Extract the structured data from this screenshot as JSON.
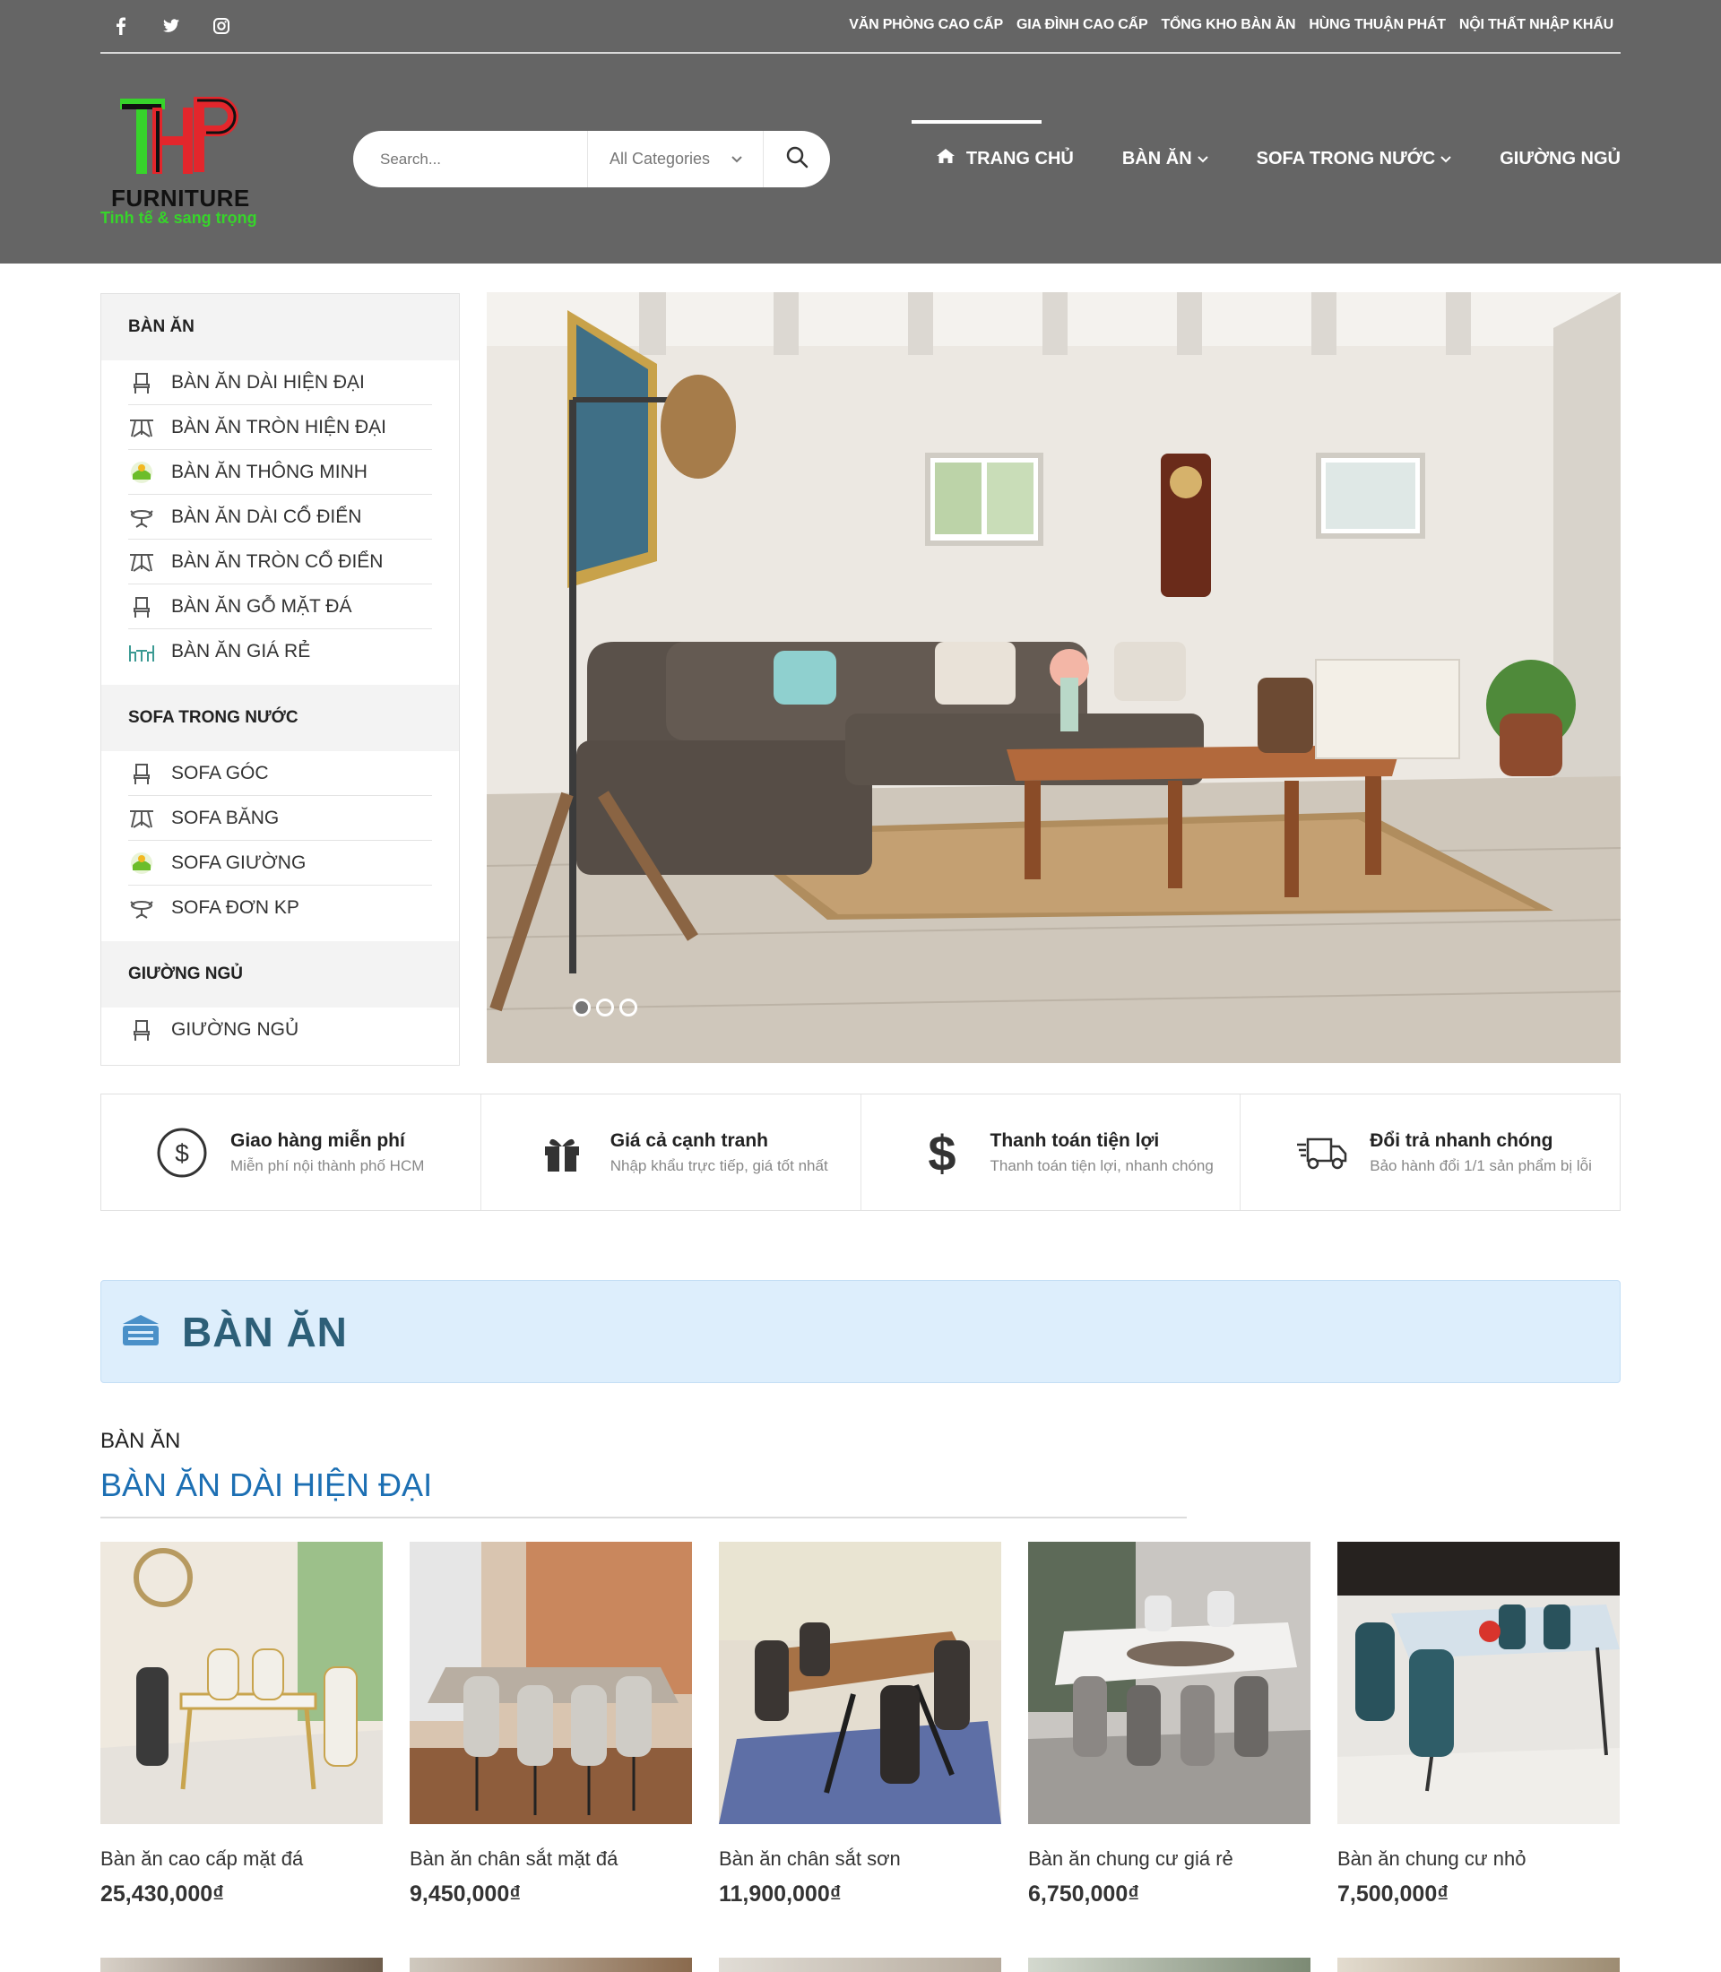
{
  "header": {
    "social": [
      "facebook-icon",
      "twitter-icon",
      "instagram-icon"
    ],
    "top_links": [
      "VĂN PHÒNG CAO CẤP",
      "GIA ĐÌNH CAO CẤP",
      "TỔNG KHO BÀN ĂN",
      "HÙNG THUẬN PHÁT",
      "NỘI THẤT NHẬP KHẨU"
    ],
    "logo": {
      "name": "FURNITURE",
      "tagline": "Tinh tế & sang trọng"
    },
    "search": {
      "placeholder": "Search...",
      "category": "All Categories"
    },
    "nav": [
      "TRANG CHỦ",
      "BÀN ĂN",
      "SOFA TRONG NƯỚC",
      "GIƯỜNG NGỦ"
    ]
  },
  "sidebar": {
    "groups": [
      {
        "title": "BÀN ĂN",
        "items": [
          "BÀN ĂN DÀI HIỆN ĐẠI",
          "BÀN ĂN TRÒN HIỆN ĐẠI",
          "BÀN ĂN THÔNG MINH",
          "BÀN ĂN DÀI CỔ ĐIỂN",
          "BÀN ĂN TRÒN CỔ ĐIỂN",
          "BÀN ĂN GỖ MẶT ĐÁ",
          "BÀN ĂN GIÁ RẺ"
        ]
      },
      {
        "title": "SOFA TRONG NƯỚC",
        "items": [
          "SOFA GÓC",
          "SOFA BĂNG",
          "SOFA GIƯỜNG",
          "SOFA ĐƠN KP"
        ]
      },
      {
        "title": "GIƯỜNG NGỦ",
        "items": [
          "GIƯỜNG NGỦ"
        ]
      }
    ]
  },
  "slider": {
    "slides": 3,
    "active": 1
  },
  "features": [
    {
      "icon": "dollar-circle-icon",
      "title": "Giao hàng miễn phí",
      "sub": "Miễn phí nội thành phố HCM"
    },
    {
      "icon": "gift-icon",
      "title": "Giá cả cạnh tranh",
      "sub": "Nhập khẩu trực tiếp, giá tốt nhất"
    },
    {
      "icon": "dollar-icon",
      "title": "Thanh toán tiện lợi",
      "sub": "Thanh toán tiện lợi, nhanh chóng"
    },
    {
      "icon": "truck-icon",
      "title": "Đổi trả nhanh chóng",
      "sub": "Bảo hành đổi 1/1 sản phẩm bị lỗi"
    }
  ],
  "section": {
    "banner_title": "BÀN ĂN",
    "sub_small": "BÀN ĂN",
    "sub_big": "BÀN ĂN DÀI HIỆN ĐẠI",
    "products": [
      {
        "name": "Bàn ăn cao cấp mặt đá",
        "price": "25,430,000₫"
      },
      {
        "name": "Bàn ăn chân sắt mặt đá",
        "price": "9,450,000₫"
      },
      {
        "name": "Bàn ăn chân sắt sơn",
        "price": "11,900,000₫"
      },
      {
        "name": "Bàn ăn chung cư giá rẻ",
        "price": "6,750,000₫"
      },
      {
        "name": "Bàn ăn chung cư nhỏ",
        "price": "7,500,000₫"
      }
    ]
  },
  "colors": {
    "header_bg": "#656565",
    "banner_bg": "#ddeefc",
    "accent_blue": "#1c6fb3",
    "logo_green": "#37d42b",
    "logo_red": "#e3262c"
  }
}
